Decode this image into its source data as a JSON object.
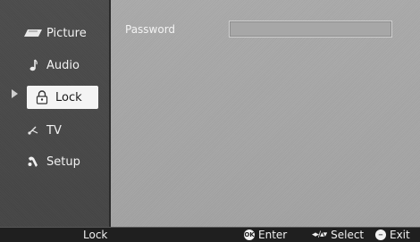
{
  "sidebar": {
    "items": [
      {
        "label": "Picture",
        "icon": "picture-icon"
      },
      {
        "label": "Audio",
        "icon": "music-note-icon"
      },
      {
        "label": "Lock",
        "icon": "lock-icon"
      },
      {
        "label": "TV",
        "icon": "tv-antenna-icon"
      },
      {
        "label": "Setup",
        "icon": "setup-icon"
      }
    ],
    "selected_index": 2
  },
  "main": {
    "password_label": "Password",
    "password_value": ""
  },
  "statusbar": {
    "title": "Lock",
    "ok_glyph": "OK",
    "enter_label": "Enter",
    "select_glyph": "◂▸/▴▾",
    "select_label": "Select",
    "exit_glyph": "−",
    "exit_label": "Exit"
  }
}
